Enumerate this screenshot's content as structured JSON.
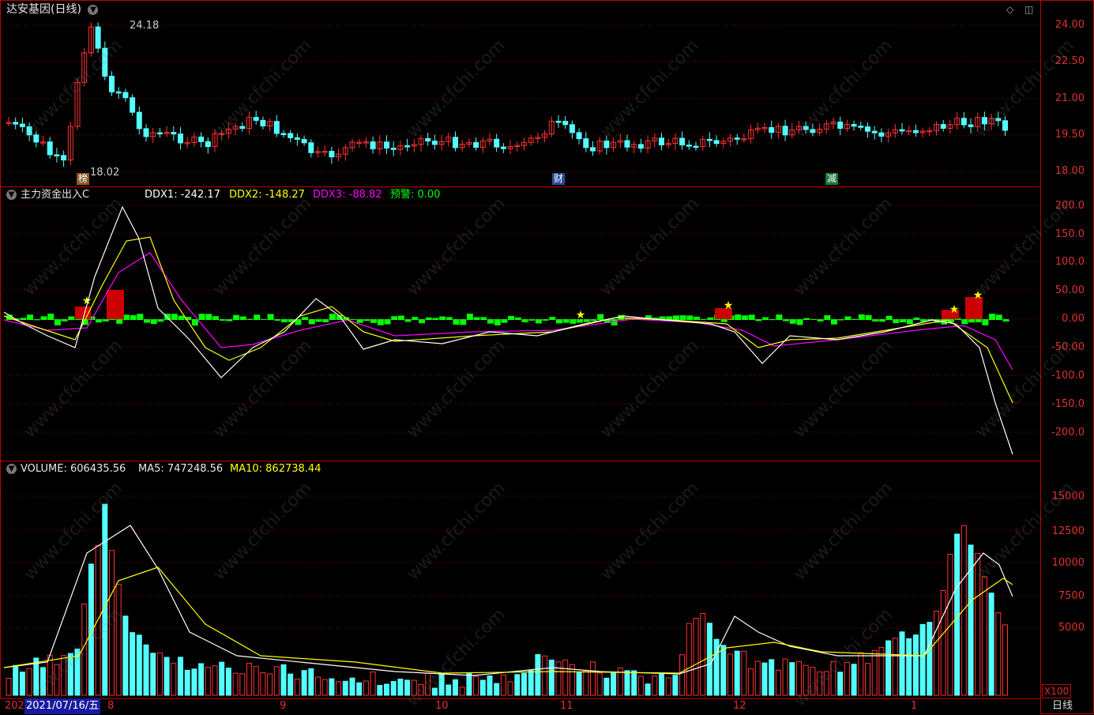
{
  "price_panel": {
    "title": "达安基因(日线)",
    "high_label": "24.18",
    "low_label": "18.02",
    "ticks": [
      "24.00",
      "22.50",
      "21.00",
      "19.50",
      "18.00"
    ],
    "tags": [
      "榜",
      "财",
      "减"
    ]
  },
  "ddx_panel": {
    "title": "主力资金出入C",
    "ddx1": "DDX1: -242.17",
    "ddx2": "DDX2: -148.27",
    "ddx3": "DDX3: -88.82",
    "alert": "预警: 0.00",
    "ticks": [
      "200.0",
      "150.0",
      "100.0",
      "50.00",
      "0.00",
      "-50.00",
      "-100.0",
      "-150.0",
      "-200.0"
    ]
  },
  "volume_panel": {
    "volume": "VOLUME: 606435.56",
    "ma5": "MA5: 747248.56",
    "ma10": "MA10: 862738.44",
    "ticks": [
      "15000",
      "12500",
      "10000",
      "7500",
      "5000"
    ],
    "unit": "X100"
  },
  "date_axis": {
    "year_partial": "202",
    "cursor_date": "2021/07/16/五",
    "months": [
      "8",
      "9",
      "10",
      "11",
      "12",
      "1"
    ],
    "period": "日线"
  },
  "watermark": "www.cfchi.com",
  "colors": {
    "up": "#ff3232",
    "down": "#54ffff",
    "border": "#c00000",
    "ddx1": "#ffffff",
    "ddx2": "#ffff00",
    "ddx3": "#ff00ff",
    "alert": "#00ff00"
  }
}
